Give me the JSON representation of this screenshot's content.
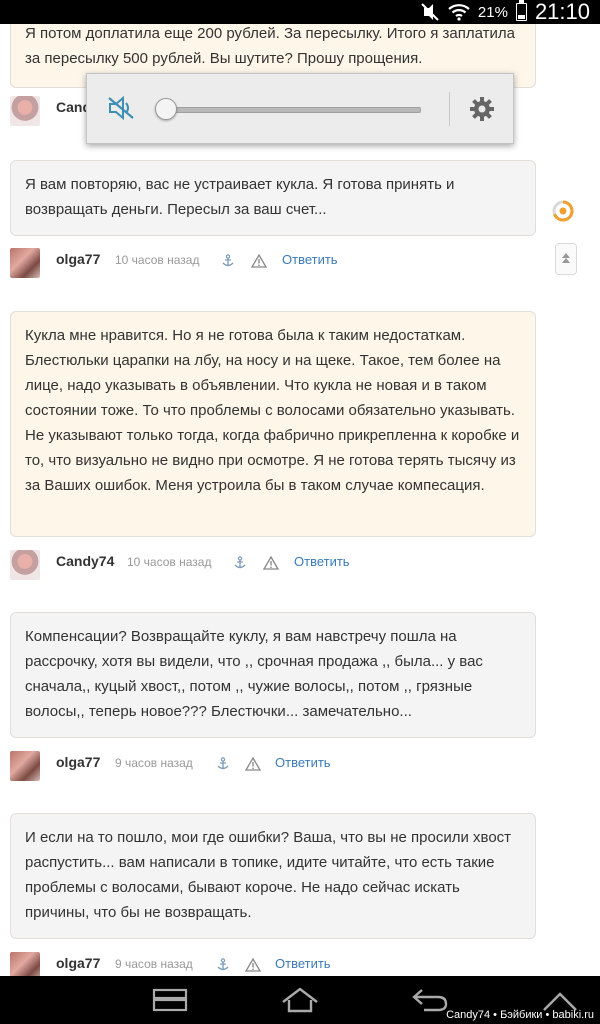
{
  "status_bar": {
    "battery": "21%",
    "time": "21:10"
  },
  "comments": [
    {
      "text": "Я потом доплатила еще 200 рублей. За пересылку. Итого я заплатила за пересылку 500 рублей. Вы шутите? Прошу прощения.",
      "author": "Candy74",
      "author_visible": "Cand"
    },
    {
      "text": "Я вам повторяю, вас не устраивает кукла. Я готова принять и возвращать деньги. Пересыл за ваш счет...",
      "author": "olga77",
      "time": "10 часов назад",
      "reply": "Ответить"
    },
    {
      "text": "Кукла мне нравится. Но я не готова была к таким недостаткам. Блестюльки царапки на лбу, на носу и на щеке. Такое, тем более на лице, надо указывать в объявлении. Что кукла не новая и в таком состоянии тоже. То что проблемы с волосами обязательно указывать. Не указывают только тогда, когда фабрично прикрепленна к коробке и то, что визуально не видно при осмотре. Я не готова терять тысячу из за Ваших ошибок. Меня устроила бы в таком случае компесация.",
      "author": "Candy74",
      "time": "10 часов назад",
      "reply": "Ответить"
    },
    {
      "text": "Компенсации? Возвращайте куклу, я вам навстречу пошла на рассрочку, хотя вы видели, что ,, срочная продажа ,, была... у вас сначала,, куцый хвост,, потом ,, чужие волосы,, потом ,, грязные волосы,, теперь новое??? Блестючки... замечательно...",
      "author": "olga77",
      "time": "9 часов назад",
      "reply": "Ответить"
    },
    {
      "text": "И если на то пошло, мои где ошибки? Ваша, что вы не просили хвост распустить... вам написали в топике, идите читайте, что есть такие проблемы с волосами, бывают короче. Не надо сейчас искать причины, что бы не возвращать.",
      "author": "olga77",
      "time": "9 часов назад",
      "reply": "Ответить"
    }
  ],
  "volume_popup": {
    "level": 0.0,
    "icons": [
      "mute-icon",
      "gear-icon"
    ]
  },
  "nav_bar": {
    "icons": [
      "recent-apps-icon",
      "home-icon",
      "back-icon",
      "menu-icon"
    ]
  },
  "watermark": "Candy74 • Бэйбики • babiki.ru",
  "colors": {
    "mine_bg": "#fdf6e9",
    "theirs_bg": "#f4f4f4",
    "link": "#3a7ab8"
  }
}
